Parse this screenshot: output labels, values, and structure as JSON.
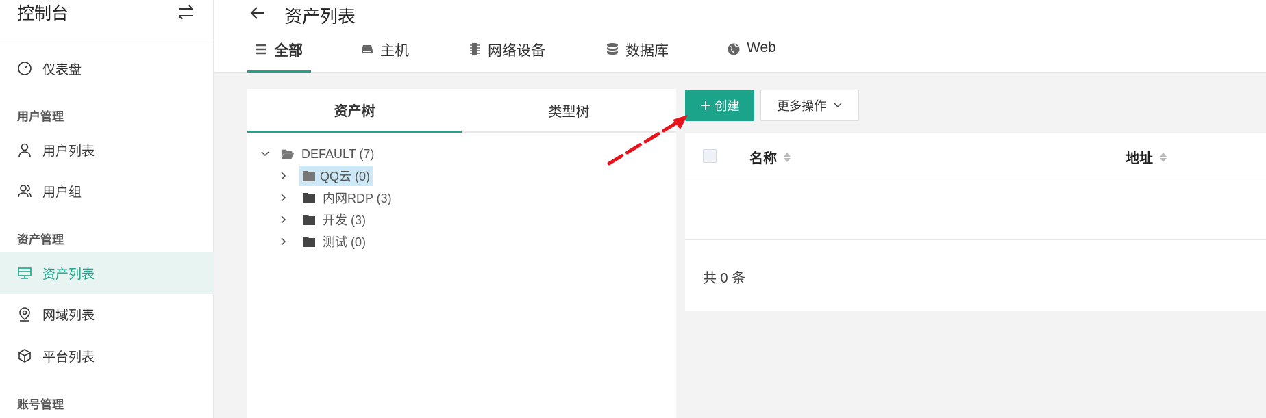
{
  "sidebar": {
    "title": "控制台",
    "items": {
      "dashboard": "仪表盘",
      "user_group_header": "用户管理",
      "user_list": "用户列表",
      "user_group": "用户组",
      "asset_group_header": "资产管理",
      "asset_list": "资产列表",
      "domain_list": "网域列表",
      "platform_list": "平台列表",
      "account_group_header": "账号管理"
    }
  },
  "header": {
    "title": "资产列表",
    "tabs": [
      {
        "label": "全部",
        "icon": "list-icon"
      },
      {
        "label": "主机",
        "icon": "host-icon"
      },
      {
        "label": "网络设备",
        "icon": "chip-icon"
      },
      {
        "label": "数据库",
        "icon": "database-icon"
      },
      {
        "label": "Web",
        "icon": "globe-icon"
      }
    ]
  },
  "tree_panel": {
    "tabs": [
      "资产树",
      "类型树"
    ],
    "root": "DEFAULT (7)",
    "children": [
      "QQ云 (0)",
      "内网RDP (3)",
      "开发 (3)",
      "测试 (0)"
    ]
  },
  "toolbar": {
    "create_label": "创建",
    "more_label": "更多操作"
  },
  "table": {
    "columns": [
      "名称",
      "地址"
    ],
    "total": "共 0 条"
  },
  "colors": {
    "accent": "#1ca48a",
    "active_bg": "#e8f4f1",
    "selection": "#cde8f6",
    "annotation": "#e8141c"
  }
}
